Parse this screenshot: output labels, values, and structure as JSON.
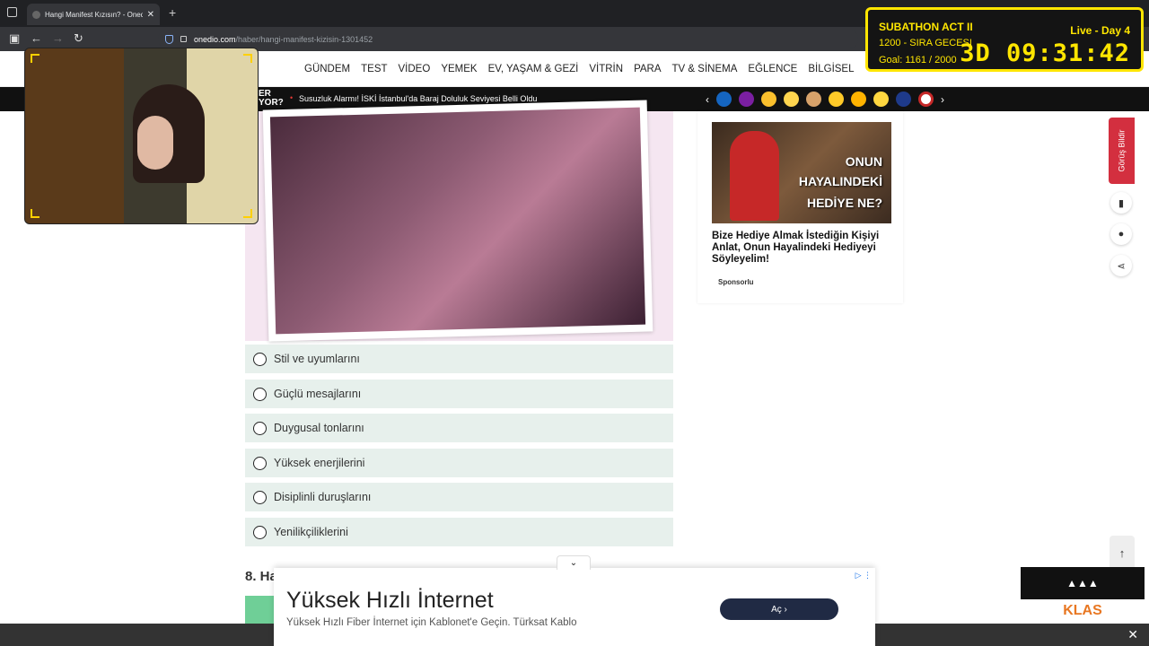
{
  "browser": {
    "tab_title": "Hangi Manifest Kızısın? - Onedi",
    "url_domain": "onedio.com",
    "url_path": "/haber/hangi-manifest-kizisin-1301452"
  },
  "site_nav": {
    "items": [
      "GÜNDEM",
      "TEST",
      "VİDEO",
      "YEMEK",
      "EV, YAŞAM & GEZİ",
      "VİTRİN",
      "PARA",
      "TV & SİNEMA",
      "EĞLENCE",
      "BİLGİSEL"
    ]
  },
  "ticker": {
    "label_line1": "ER",
    "label_line2": "YOR?",
    "headline": "Susuzluk Alarmı! İSKİ İstanbul'da Baraj Doluluk Seviyesi Belli Oldu"
  },
  "reaction_emojis": [
    "emoji-reaction-1",
    "emoji-reaction-2",
    "emoji-reaction-3",
    "emoji-reaction-4",
    "emoji-reaction-5",
    "emoji-reaction-6",
    "emoji-reaction-7",
    "emoji-reaction-8",
    "emoji-reaction-9",
    "emoji-reaction-10"
  ],
  "quiz": {
    "options": [
      "Stil ve uyumlarını",
      "Güçlü mesajlarını",
      "Duygusal tonlarını",
      "Yüksek enerjilerini",
      "Disiplinli duruşlarını",
      "Yenilikçiliklerini"
    ],
    "next_question_prefix": "8. Ha"
  },
  "side_ad": {
    "image_text_1": "ONUN",
    "image_text_2": "HAYALINDEKİ",
    "image_text_3": "HEDİYE NE?",
    "title": "Bize Hediye Almak İstediğin Kişiyi Anlat, Onun Hayalindeki Hediyeyi Söyleyelim!",
    "sponsor": "Sponsorlu"
  },
  "feedback_label": "Görüş Bildir",
  "subathon": {
    "title": "SUBATHON ACT II",
    "line2": "1200 - SIRA GECESI",
    "goal": "Goal: 1161 / 2000",
    "status": "Live - Day 4",
    "timer": "3D 09:31:42"
  },
  "bottom_ad": {
    "headline": "Yüksek Hızlı İnternet",
    "subline": "Yüksek Hızlı Fiber İnternet için Kablonet'e Geçin. Türksat Kablo",
    "button": "Aç"
  },
  "klas_ad": {
    "brand": "KLAS"
  }
}
